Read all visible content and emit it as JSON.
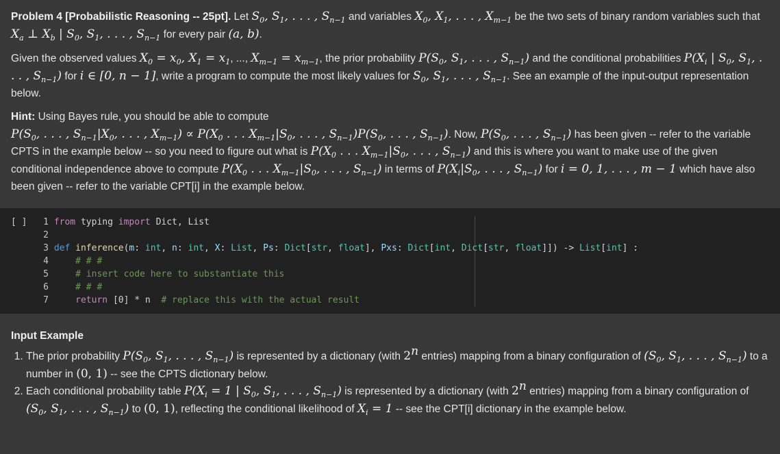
{
  "problem": {
    "title": "Problem 4 [Probabilistic Reasoning -- 25pt].",
    "p1_a": " Let ",
    "p1_b": " and variables ",
    "p1_c": " be the two sets of binary random variables such that ",
    "p1_d": " for every pair ",
    "p2_a": "Given the observed values ",
    "p2_b": ", the prior probability ",
    "p2_c": " and the conditional probabilities ",
    "p2_d": " for ",
    "p2_e": ", write a program to compute the most likely values for ",
    "p2_f": ". See an example of the input-output representation below.",
    "hint_label": "Hint:",
    "hint_a": " Using Bayes rule, you should be able to compute",
    "hint_b": ". Now, ",
    "hint_c": " has been given -- refer to the variable CPTS in the example below -- so you need to figure out what is ",
    "hint_d": " and this is where you want to make use of the given conditional independence above to compute ",
    "hint_e": " in terms of ",
    "hint_f": " for ",
    "hint_g": " which have also been given -- refer to the variable CPT[i] in the example below."
  },
  "code_cell": {
    "run_marker": "[ ]",
    "lines": [
      {
        "n": "1",
        "text": "from typing import Dict, List"
      },
      {
        "n": "2",
        "text": ""
      },
      {
        "n": "3",
        "text": "def inference(m: int, n: int, X: List, Ps: Dict[str, float], Pxs: Dict[int, Dict[str, float]]) -> List[int] :"
      },
      {
        "n": "4",
        "text": "    # # #"
      },
      {
        "n": "5",
        "text": "    # insert code here to substantiate this"
      },
      {
        "n": "6",
        "text": "    # # #"
      },
      {
        "n": "7",
        "text": "    return [0] * n  # replace this with the actual result"
      }
    ]
  },
  "input_example": {
    "heading": "Input Example",
    "item1_a": "The prior probability ",
    "item1_b": " is represented by a dictionary (with ",
    "item1_c": " entries) mapping from a binary configuration of ",
    "item1_d": " to a number in ",
    "item1_e": " -- see the CPTS dictionary below.",
    "item2_a": "Each conditional probability table ",
    "item2_b": " is represented by a dictionary (with ",
    "item2_c": " entries) mapping from a binary configuration of ",
    "item2_d": " to ",
    "item2_e": ", reflecting the conditional likelihood of ",
    "item2_f": " -- see the CPT[i] dictionary in the example below."
  },
  "colors": {
    "background": "#383838",
    "code_background": "#212121",
    "text": "#e3e3e3"
  }
}
